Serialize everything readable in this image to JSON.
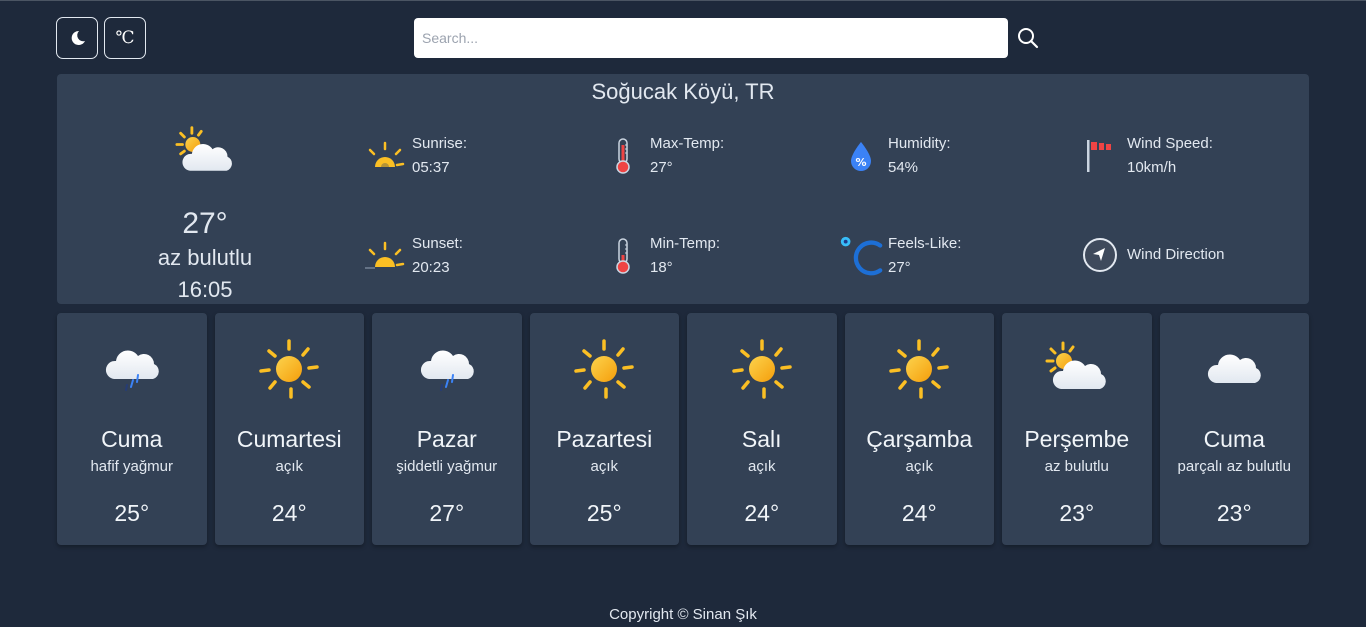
{
  "header": {
    "theme_toggle_icon": "moon-icon",
    "unit_toggle_label": "℃",
    "search_placeholder": "Search...",
    "search_value": "",
    "search_icon": "search-icon"
  },
  "current": {
    "location": "Soğucak Köyü, TR",
    "icon": "partly-cloudy-icon",
    "temp": "27°",
    "description": "az bulutlu",
    "time": "16:05",
    "stats": {
      "sunrise": {
        "label": "Sunrise:",
        "value": "05:37"
      },
      "sunset": {
        "label": "Sunset:",
        "value": "20:23"
      },
      "max_temp": {
        "label": "Max-Temp:",
        "value": "27°"
      },
      "min_temp": {
        "label": "Min-Temp:",
        "value": "18°"
      },
      "humidity": {
        "label": "Humidity:",
        "value": "54%"
      },
      "feels_like": {
        "label": "Feels-Like:",
        "value": "27°"
      },
      "wind_speed": {
        "label": "Wind Speed:",
        "value": "10km/h"
      },
      "wind_direction": {
        "label": "Wind Direction"
      }
    }
  },
  "forecast": [
    {
      "day": "Cuma",
      "description": "hafif yağmur",
      "temp": "25°",
      "icon": "rain"
    },
    {
      "day": "Cumartesi",
      "description": "açık",
      "temp": "24°",
      "icon": "sun"
    },
    {
      "day": "Pazar",
      "description": "şiddetli yağmur",
      "temp": "27°",
      "icon": "rain"
    },
    {
      "day": "Pazartesi",
      "description": "açık",
      "temp": "25°",
      "icon": "sun"
    },
    {
      "day": "Salı",
      "description": "açık",
      "temp": "24°",
      "icon": "sun"
    },
    {
      "day": "Çarşamba",
      "description": "açık",
      "temp": "24°",
      "icon": "sun"
    },
    {
      "day": "Perşembe",
      "description": "az bulutlu",
      "temp": "23°",
      "icon": "partly-cloudy"
    },
    {
      "day": "Cuma",
      "description": "parçalı az bulutlu",
      "temp": "23°",
      "icon": "cloud"
    }
  ],
  "footer": {
    "text": "Copyright © Sinan Şık"
  },
  "colors": {
    "background": "#1e293b",
    "card": "#334155",
    "sun": "#fbbf24",
    "thermometer": "#ef4444",
    "humidity": "#3b82f6",
    "feels_like": "#1d6fd6",
    "windsock": "#ef4444"
  }
}
